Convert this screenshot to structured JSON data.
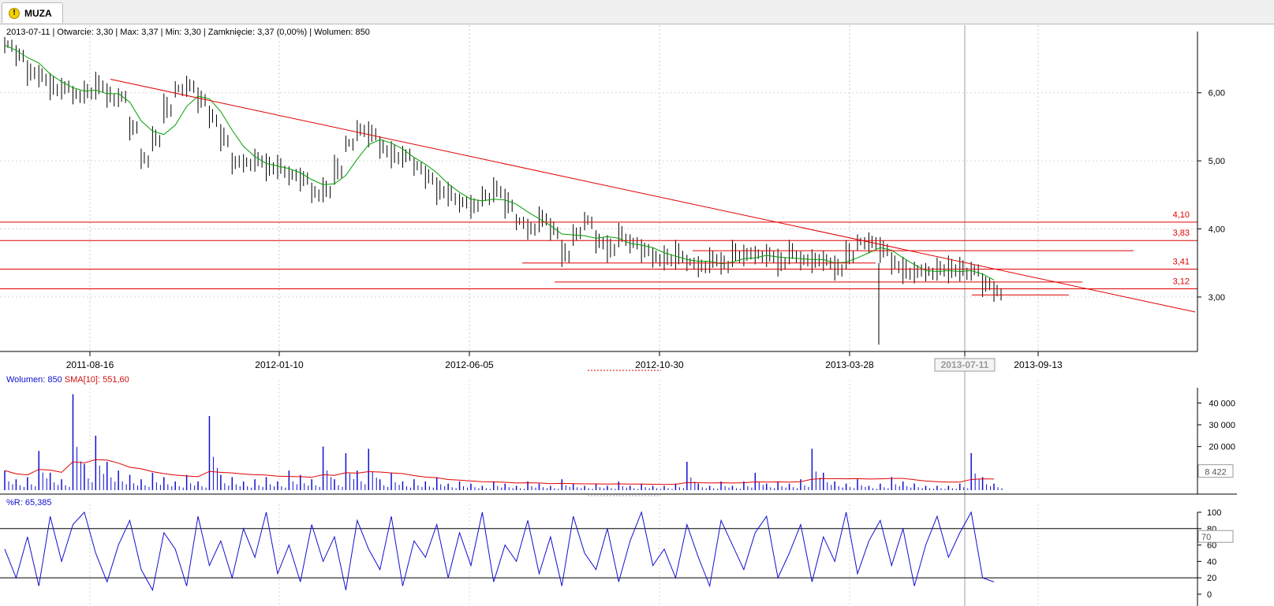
{
  "tab": {
    "label": "MUZA",
    "icon": "warning-icon"
  },
  "info_line": "2013-07-11 | Otwarcie: 3,30 | Max: 3,37 | Min: 3,30 | Zamknięcie: 3,37 (0,00%)  | Wolumen: 850",
  "volume_legend": {
    "volume": "Wolumen: 850",
    "sma": "SMA[10]: 551,60"
  },
  "wr_legend": "%R: 65,385",
  "colors": {
    "candle": "#000000",
    "sma_price": "#00a000",
    "trend": "#e00000",
    "volume": "#1010d0",
    "volume_sma": "#e00000",
    "wr": "#1010d0"
  },
  "chart_data": [
    {
      "type": "line",
      "title": "MUZA",
      "x_ticks": [
        "2011-08-16",
        "2012-01-10",
        "2012-06-05",
        "2012-10-30",
        "2013-03-28",
        "2013-07-11",
        "2013-09-13"
      ],
      "y_ticks": [
        "3,00",
        "4,00",
        "5,00",
        "6,00"
      ],
      "ylim": [
        2.2,
        6.9
      ],
      "cursor_date": "2013-07-11",
      "horizontal_levels": [
        {
          "label": "4,10",
          "value": 4.1
        },
        {
          "label": "3,83",
          "value": 3.83
        },
        {
          "label": "3,41",
          "value": 3.41
        },
        {
          "label": "3,12",
          "value": 3.12
        }
      ],
      "series": [
        {
          "values": [
            6.7,
            6.55,
            6.3,
            6.2,
            6.05,
            6.1,
            5.95,
            6.0,
            6.1,
            5.9,
            5.95,
            5.5,
            5.0,
            5.3,
            5.75,
            6.05,
            6.1,
            5.9,
            5.6,
            5.3,
            5.0,
            4.95,
            5.0,
            4.9,
            4.85,
            4.8,
            4.75,
            4.5,
            4.55,
            4.85,
            5.25,
            5.45,
            5.4,
            5.15,
            5.05,
            5.1,
            4.9,
            4.75,
            4.55,
            4.45,
            4.4,
            4.35,
            4.45,
            4.55,
            4.35,
            4.1,
            4.0,
            4.15,
            3.95,
            3.6,
            3.95,
            4.1,
            3.8,
            3.7,
            3.85,
            3.8,
            3.7,
            3.55,
            3.55,
            3.6,
            3.5,
            3.45,
            3.55,
            3.45,
            3.6,
            3.65,
            3.6,
            3.6,
            3.5,
            3.6,
            3.55,
            3.55,
            3.5,
            3.4,
            3.6,
            3.8,
            3.8,
            3.7,
            3.45,
            3.35,
            3.4,
            3.35,
            3.4,
            3.4,
            3.35,
            3.4,
            3.2,
            3.05
          ]
        }
      ]
    },
    {
      "type": "bar",
      "title": "Wolumen",
      "y_ticks": [
        "20 000",
        "30 000",
        "40 000"
      ],
      "ylim": [
        0,
        47000
      ],
      "value_box": "8 422",
      "series": [
        {
          "name": "Wolumen",
          "values": [
            9000,
            5000,
            6000,
            18000,
            8000,
            5000,
            44000,
            12000,
            25000,
            13000,
            9000,
            7000,
            5000,
            8000,
            6000,
            4000,
            7000,
            4000,
            34000,
            7000,
            6000,
            4000,
            5000,
            6000,
            4000,
            9000,
            7000,
            5000,
            20000,
            5000,
            17000,
            9000,
            19000,
            5000,
            8000,
            4000,
            5000,
            4000,
            6000,
            3000,
            4000,
            3000,
            2000,
            4000,
            3000,
            2000,
            4000,
            3000,
            2000,
            5000,
            3000,
            2000,
            3000,
            2000,
            4000,
            2000,
            3000,
            2000,
            2000,
            3000,
            13000,
            3000,
            2000,
            4000,
            2000,
            4000,
            8000,
            3000,
            4000,
            3000,
            5000,
            19000,
            8000,
            4000,
            3000,
            5000,
            2000,
            3000,
            6000,
            4000,
            3000,
            2000,
            2000,
            2000,
            3000,
            17000,
            6000,
            3000
          ]
        },
        {
          "name": "SMA[10]",
          "values": [
            9000,
            7500,
            7000,
            9500,
            9200,
            8200,
            13000,
            12500,
            14000,
            13800,
            12400,
            10500,
            9800,
            8500,
            7600,
            6900,
            6500,
            6200,
            8600,
            8200,
            7900,
            7400,
            7100,
            6900,
            6400,
            6300,
            6200,
            5900,
            7100,
            6800,
            8000,
            7800,
            8500,
            8300,
            7900,
            7600,
            6700,
            6000,
            5700,
            4900,
            4600,
            4200,
            3900,
            3800,
            3600,
            3300,
            3400,
            3300,
            3000,
            3100,
            3000,
            2900,
            2900,
            2800,
            2900,
            2800,
            2800,
            2700,
            2600,
            2700,
            3500,
            3400,
            3300,
            3400,
            3300,
            3400,
            3800,
            3700,
            3800,
            3700,
            3900,
            5000,
            5300,
            5300,
            5200,
            5300,
            5100,
            5200,
            5400,
            5400,
            4800,
            4200,
            3900,
            3700,
            3700,
            4900,
            5200,
            5100
          ]
        }
      ]
    },
    {
      "type": "line",
      "title": "%R",
      "y_ticks": [
        "0",
        "20",
        "40",
        "60",
        "80",
        "100"
      ],
      "ylim": [
        0,
        100
      ],
      "levels": [
        20,
        80
      ],
      "value_box": "70",
      "series": [
        {
          "name": "%R",
          "values": [
            55,
            20,
            70,
            10,
            95,
            40,
            85,
            100,
            50,
            15,
            60,
            90,
            30,
            5,
            75,
            55,
            10,
            95,
            35,
            65,
            20,
            80,
            45,
            100,
            25,
            60,
            15,
            85,
            40,
            70,
            5,
            90,
            55,
            30,
            95,
            10,
            65,
            45,
            85,
            20,
            75,
            35,
            100,
            15,
            60,
            40,
            90,
            25,
            70,
            10,
            95,
            50,
            30,
            80,
            15,
            65,
            100,
            35,
            55,
            20,
            85,
            45,
            10,
            90,
            60,
            30,
            75,
            95,
            20,
            50,
            85,
            15,
            70,
            40,
            100,
            25,
            65,
            90,
            35,
            80,
            10,
            60,
            95,
            45,
            75,
            100,
            20,
            15
          ]
        }
      ]
    }
  ]
}
